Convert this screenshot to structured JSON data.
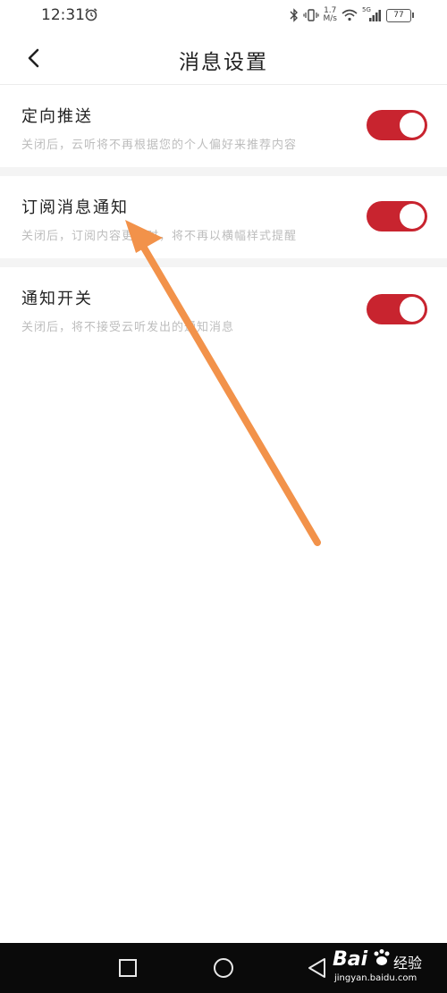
{
  "status_bar": {
    "time": "12:31",
    "net_speed_value": "1.7",
    "net_speed_unit": "M/s",
    "battery": "77",
    "signal_label": "5G"
  },
  "header": {
    "title": "消息设置"
  },
  "settings": [
    {
      "title": "定向推送",
      "description": "关闭后，云听将不再根据您的个人偏好来推荐内容",
      "enabled": true
    },
    {
      "title": "订阅消息通知",
      "description": "关闭后，订阅内容更新时，将不再以横幅样式提醒",
      "enabled": true
    },
    {
      "title": "通知开关",
      "description": "关闭后，将不接受云听发出的通知消息",
      "enabled": true
    }
  ],
  "colors": {
    "toggle_on": "#c8242f",
    "arrow": "#f2924a"
  },
  "watermark": {
    "brand": "Bai",
    "brand_cn": "经验",
    "url": "jingyan.baidu.com"
  }
}
